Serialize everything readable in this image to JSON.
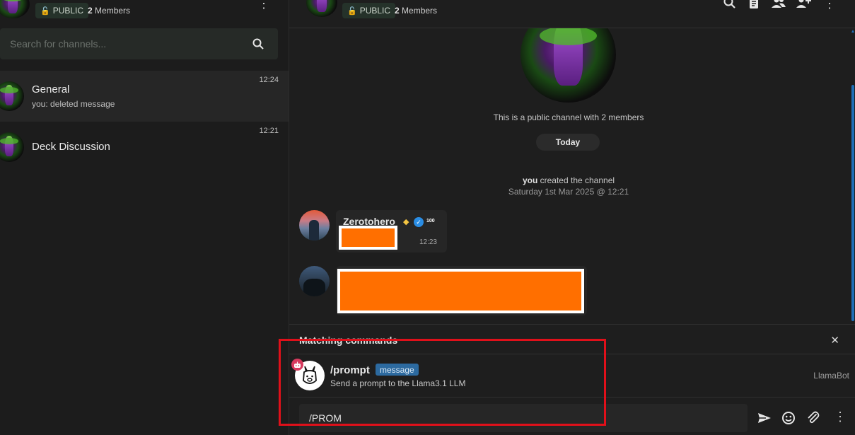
{
  "sidebar": {
    "header": {
      "visibility": "PUBLIC",
      "member_count": "2",
      "members_label": "Members"
    },
    "search": {
      "placeholder": "Search for channels..."
    },
    "channels": [
      {
        "name": "General",
        "last_message": "you: deleted message",
        "time": "12:24",
        "active": true
      },
      {
        "name": "Deck Discussion",
        "last_message": "",
        "time": "12:21",
        "active": false
      }
    ]
  },
  "channel_header": {
    "visibility": "PUBLIC",
    "member_count": "2",
    "members_label": "Members"
  },
  "chat": {
    "channel_info": "This is a public channel with 2 members",
    "date_divider": "Today",
    "system_message": {
      "actor": "you",
      "text": "created the channel",
      "timestamp": "Saturday 1st Mar 2025 @ 12:21"
    },
    "messages": [
      {
        "author": "Zerotohero",
        "time": "12:23",
        "badges": [
          "gem-icon",
          "verified-icon",
          "100-icon"
        ],
        "content": "[redacted]"
      },
      {
        "author": "",
        "time": "",
        "content": "[redacted]"
      }
    ]
  },
  "commands": {
    "title": "Matching commands",
    "items": [
      {
        "name": "/prompt",
        "tag": "message",
        "description": "Send a prompt to the Llama3.1 LLM",
        "provider": "LlamaBot"
      }
    ]
  },
  "composer": {
    "value": "/PROM"
  },
  "colors": {
    "accent": "#1f6fb7",
    "public_lock": "#3ec35a",
    "command_tag": "#2c6aa0",
    "redaction": "#ff6f00",
    "highlight": "#e0101a"
  }
}
